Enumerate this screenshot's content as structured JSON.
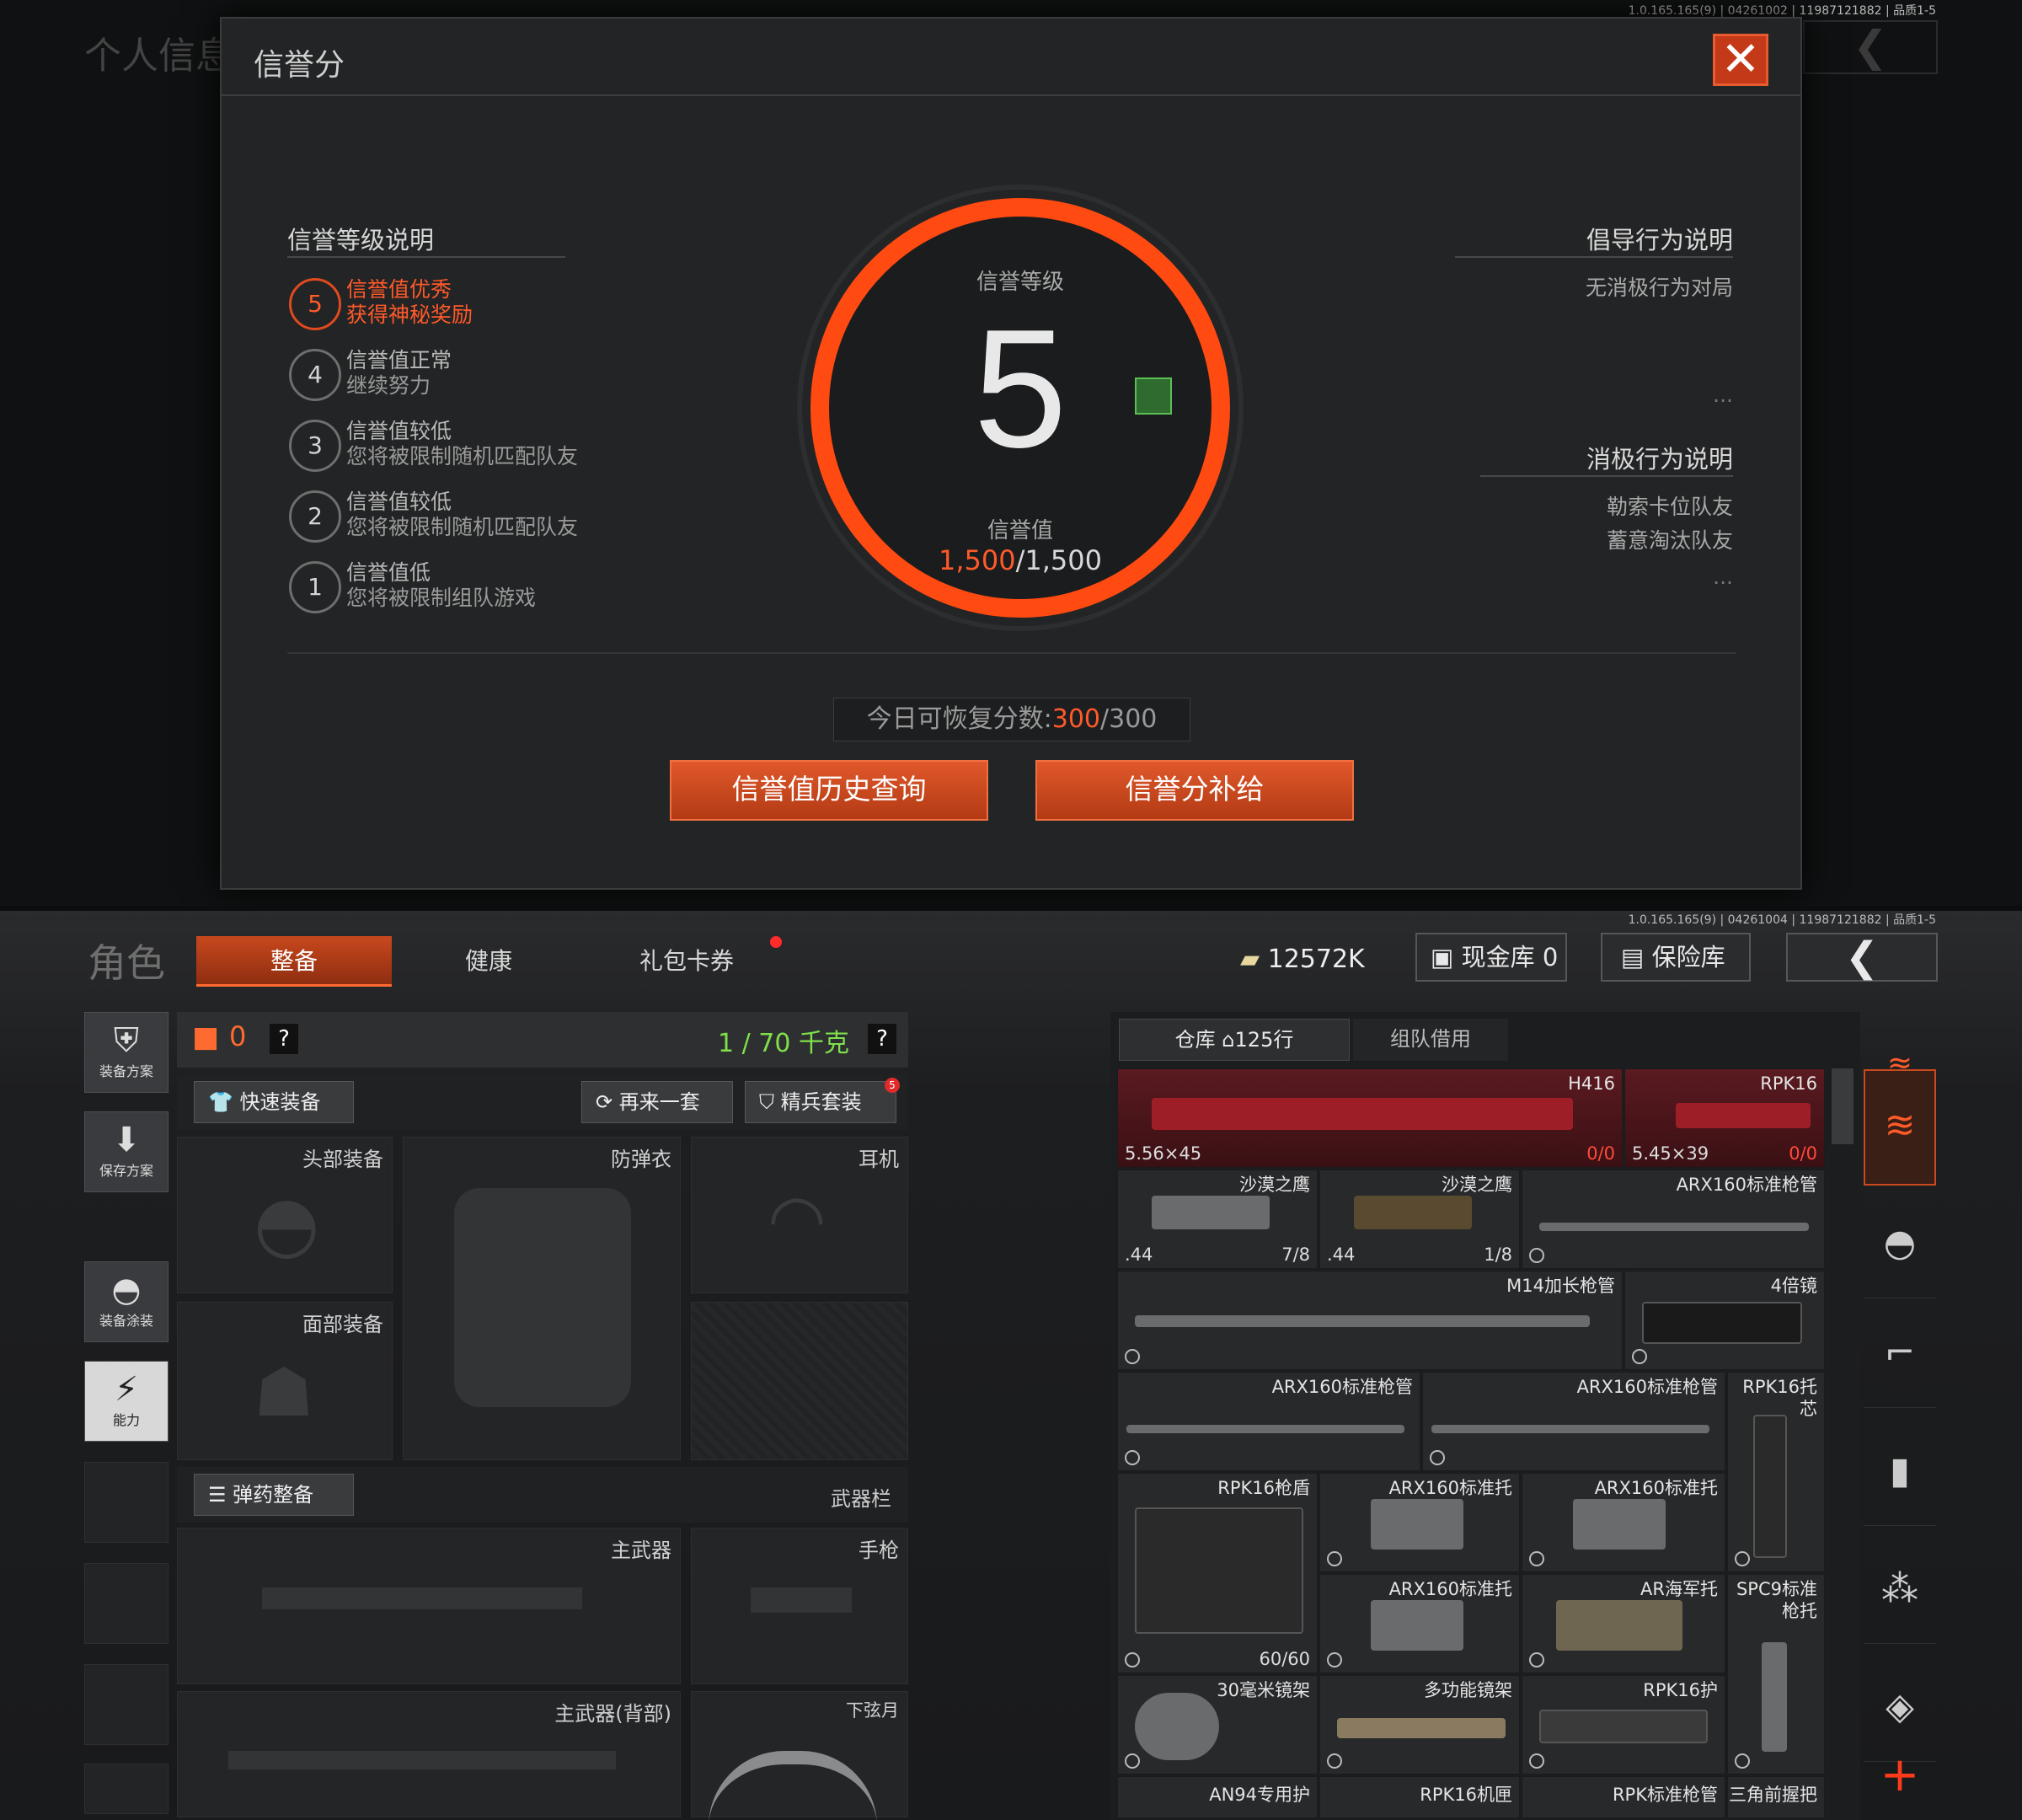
{
  "top": {
    "version": "1.0.165.165(9) | 04261002 | 11987121882 | 品质1-5",
    "bg_title": "个人信息",
    "modal": {
      "title": "信誉分",
      "levels_header": "信誉等级说明",
      "levels": [
        {
          "num": "5",
          "line1": "信誉值优秀",
          "line2": "获得神秘奖励",
          "active": true
        },
        {
          "num": "4",
          "line1": "信誉值正常",
          "line2": "继续努力"
        },
        {
          "num": "3",
          "line1": "信誉值较低",
          "line2": "您将被限制随机匹配队友"
        },
        {
          "num": "2",
          "line1": "信誉值较低",
          "line2": "您将被限制随机匹配队友"
        },
        {
          "num": "1",
          "line1": "信誉值低",
          "line2": "您将被限制组队游戏"
        }
      ],
      "gauge": {
        "level_label": "信誉等级",
        "level_value": "5",
        "score_label": "信誉值",
        "score_current": "1,500",
        "score_max": "/1,500",
        "progress": 1.0
      },
      "good_header": "倡导行为说明",
      "good_items": [
        "无消极行为对局"
      ],
      "bad_header": "消极行为说明",
      "bad_items": [
        "勒索卡位队友",
        "蓄意淘汰队友"
      ],
      "ellipsis": "...",
      "recover_prefix": "今日可恢复分数:",
      "recover_current": "300",
      "recover_max": "/300",
      "history_button": "信誉值历史查询",
      "supply_button": "信誉分补给"
    }
  },
  "bottom": {
    "version": "1.0.165.165(9) | 04261004 | 11987121882 | 品质1-5",
    "title": "角色",
    "tabs": [
      "整备",
      "健康",
      "礼包卡券"
    ],
    "money": "12572K",
    "cash_label": "现金库 0",
    "safe_label": "保险库",
    "side": [
      "装备方案",
      "保存方案",
      "装备涂装",
      "能力"
    ],
    "loadout": {
      "bag_count": "0",
      "help": "?",
      "weight": "1 / 70 千克",
      "quick_equip": "快速装备",
      "again": "再来一套",
      "elite": "精兵套装",
      "elite_badge": "5",
      "head": "头部装备",
      "armor": "防弹衣",
      "ear": "耳机",
      "face": "面部装备",
      "ammo": "弹药整备",
      "weapon_bar": "武器栏",
      "primary": "主武器",
      "pistol": "手枪",
      "primary_back": "主武器(背部)",
      "melee": "下弦月"
    },
    "storage": {
      "tab1": "仓库",
      "tab1_count": "125行",
      "tab2": "组队借用",
      "items": [
        {
          "name": "H416",
          "bl": "5.56×45",
          "br": "0/0"
        },
        {
          "name": "RPK16",
          "bl": "5.45×39",
          "br": "0/0"
        },
        {
          "name": "沙漠之鹰",
          "bl": ".44",
          "br": "7/8"
        },
        {
          "name": "沙漠之鹰",
          "bl": ".44",
          "br": "1/8"
        },
        {
          "name": "ARX160标准枪管"
        },
        {
          "name": "M14加长枪管"
        },
        {
          "name": "4倍镜"
        },
        {
          "name": "ARX160标准枪管"
        },
        {
          "name": "ARX160标准枪管"
        },
        {
          "name": "RPK16托芯"
        },
        {
          "name": "RPK16枪盾",
          "br": "60/60"
        },
        {
          "name": "ARX160标准托"
        },
        {
          "name": "ARX160标准托"
        },
        {
          "name": "ARX160标准托"
        },
        {
          "name": "AR海军托"
        },
        {
          "name": "SPC9标准枪托"
        },
        {
          "name": "30毫米镜架"
        },
        {
          "name": "多功能镜架"
        },
        {
          "name": "RPK16护"
        },
        {
          "name": "AN94专用护"
        },
        {
          "name": "RPK16机匣"
        },
        {
          "name": "RPK标准枪管"
        },
        {
          "name": "三角前握把"
        }
      ]
    }
  }
}
